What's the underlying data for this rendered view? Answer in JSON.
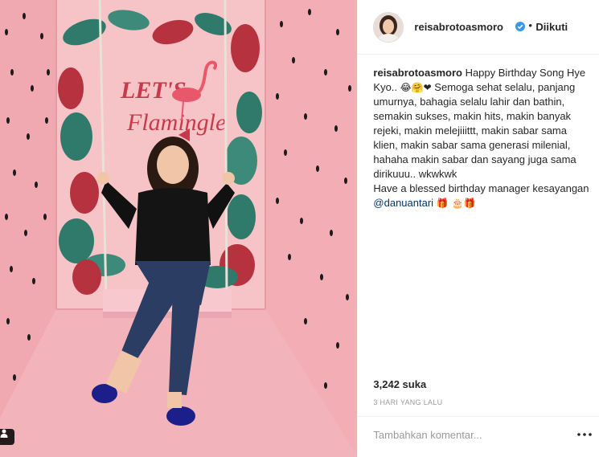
{
  "post": {
    "username": "reisabrotoasmoro",
    "follow_separator": "•",
    "follow_state": "Diikuti",
    "caption": {
      "user": "reisabrotoasmoro",
      "line1": " Happy Birthday Song Hye Kyo.. ",
      "emoji1": "😂🤗❤",
      "line2": " Semoga sehat selalu, panjang umurnya, bahagia selalu lahir dan bathin, semakin sukses, makin hits, makin banyak rejeki, makin melejiiittt, makin sabar sama klien, makin sabar sama generasi milenial, hahaha makin sabar dan sayang juga sama dirikuuu.. wkwkwk",
      "line3": "Have a blessed birthday manager kesayangan ",
      "mention": "@danuantari",
      "emoji2": " 🎁 🎂🎁"
    },
    "likes": "3,242 suka",
    "timestamp": "3 HARI YANG LALU",
    "comment_placeholder": "Tambahkan komentar...",
    "more_label": "•••"
  },
  "photo": {
    "sign_text_line1": "LET'S",
    "sign_text_line2": "Flamingle",
    "colors": {
      "wall": "#f4b7bb",
      "floor": "#f2a9b2",
      "sign": "#c73a4b",
      "leaf_green": "#2f7a6b",
      "leaf_red": "#b7323f",
      "shirt": "#111111",
      "jeans": "#2b3d63"
    }
  },
  "theme": {
    "link": "#003569",
    "verified": "#3897f0",
    "muted": "#999999",
    "border": "#efefef"
  }
}
